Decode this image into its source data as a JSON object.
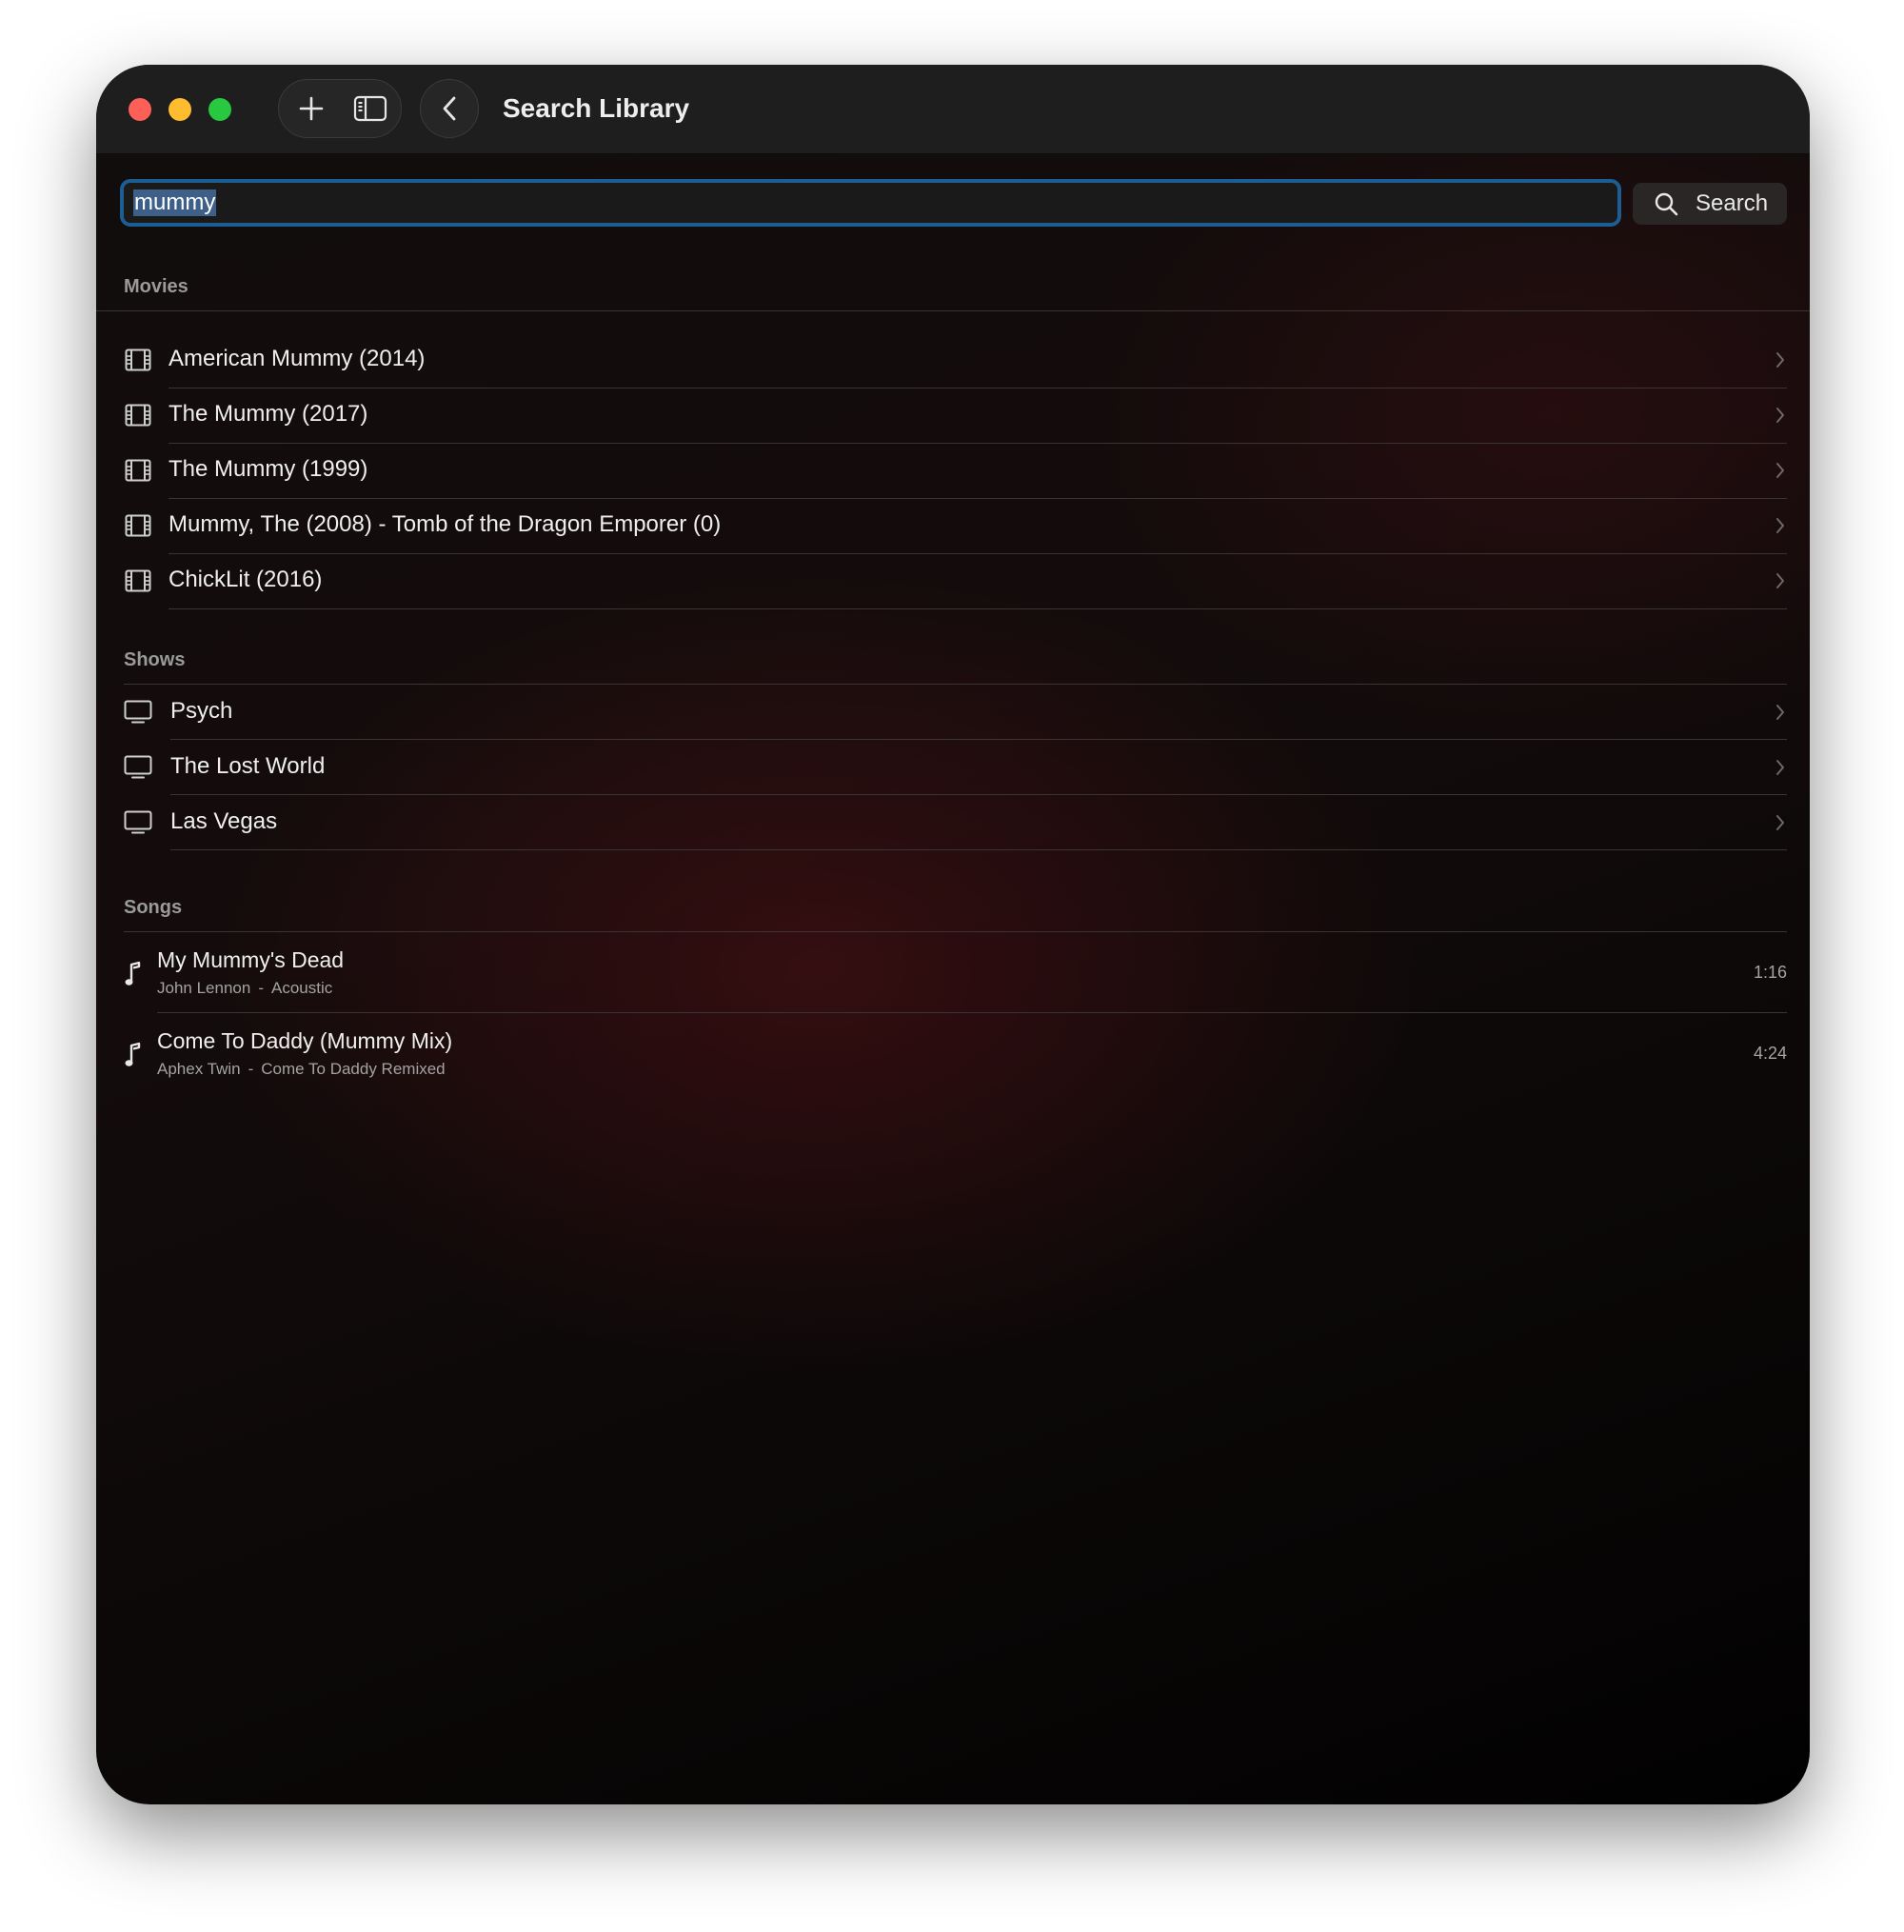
{
  "window": {
    "title": "Search Library"
  },
  "toolbar": {
    "add_icon": "plus-icon",
    "sidebar_icon": "sidebar-icon",
    "back_icon": "chevron-left-icon"
  },
  "search": {
    "query": "mummy",
    "button_label": "Search",
    "button_icon": "magnifying-glass-icon"
  },
  "sections": {
    "movies": {
      "header": "Movies",
      "icon": "film-icon",
      "items": [
        {
          "label": "American Mummy (2014)"
        },
        {
          "label": "The Mummy (2017)"
        },
        {
          "label": "The Mummy (1999)"
        },
        {
          "label": "Mummy, The (2008) - Tomb of the Dragon Emporer (0)"
        },
        {
          "label": "ChickLit (2016)"
        }
      ]
    },
    "shows": {
      "header": "Shows",
      "icon": "tv-icon",
      "items": [
        {
          "label": "Psych"
        },
        {
          "label": "The Lost World"
        },
        {
          "label": "Las Vegas"
        }
      ]
    },
    "songs": {
      "header": "Songs",
      "icon": "music-note-icon",
      "items": [
        {
          "title": "My Mummy's Dead",
          "artist": "John Lennon",
          "album": "Acoustic",
          "duration": "1:16"
        },
        {
          "title": "Come To Daddy (Mummy Mix)",
          "artist": "Aphex Twin",
          "album": "Come To Daddy Remixed",
          "duration": "4:24"
        }
      ]
    }
  },
  "colors": {
    "accent_focus": "#1c5d94",
    "close": "#fe5f57",
    "minimize": "#febc2e",
    "maximize": "#28c840"
  }
}
